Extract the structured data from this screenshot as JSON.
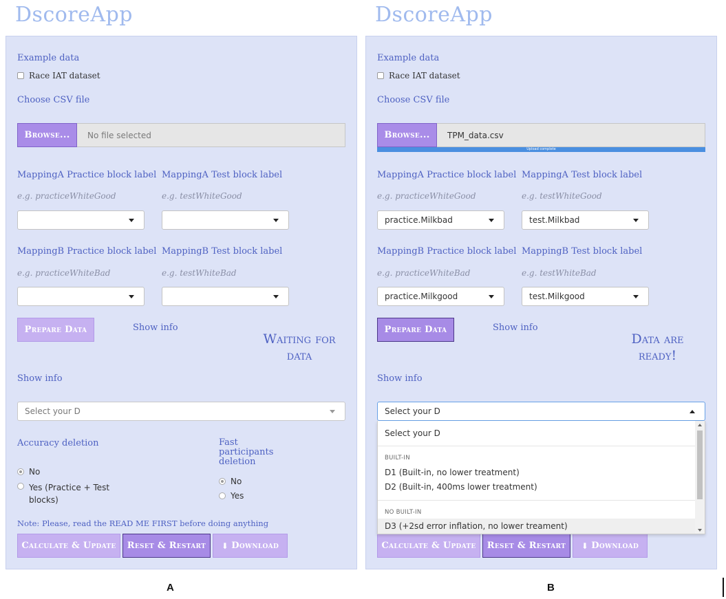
{
  "app_title": "DscoreApp",
  "panels": [
    {
      "figure_label": "A",
      "example_data_label": "Example data",
      "race_iat_label": "Race IAT dataset",
      "choose_csv_label": "Choose CSV file",
      "browse_label": "Browse...",
      "file_status": "No file selected",
      "mappingA_practice_label": "MappingA Practice block label",
      "mappingA_practice_hint": "e.g. practiceWhiteGood",
      "mappingA_practice_value": "",
      "mappingA_test_label": "MappingA Test block label",
      "mappingA_test_hint": "e.g. testWhiteGood",
      "mappingA_test_value": "",
      "mappingB_practice_label": "MappingB Practice block label",
      "mappingB_practice_hint": "e.g. practiceWhiteBad",
      "mappingB_practice_value": "",
      "mappingB_test_label": "MappingB Test block label",
      "mappingB_test_hint": "e.g. testWhiteBad",
      "mappingB_test_value": "",
      "prepare_label": "Prepare Data",
      "show_info_1": "Show info",
      "status_line1": "Waiting for",
      "status_line2": "data",
      "show_info_2": "Show info",
      "d_select_placeholder": "Select your D",
      "accuracy_label": "Accuracy deletion",
      "accuracy_no": "No",
      "accuracy_yes": "Yes (Practice + Test blocks)",
      "fast_label": "Fast participants deletion",
      "fast_no": "No",
      "fast_yes": "Yes",
      "note": "Note: Please, read the READ ME FIRST before doing anything",
      "calc_label": "Calculate & Update",
      "reset_label": "Reset & Restart",
      "download_label": "Download"
    },
    {
      "figure_label": "B",
      "example_data_label": "Example data",
      "race_iat_label": "Race IAT dataset",
      "choose_csv_label": "Choose CSV file",
      "browse_label": "Browse...",
      "file_status": "TPM_data.csv",
      "upload_status": "Upload complete",
      "mappingA_practice_label": "MappingA Practice block label",
      "mappingA_practice_hint": "e.g. practiceWhiteGood",
      "mappingA_practice_value": "practice.Milkbad",
      "mappingA_test_label": "MappingA Test block label",
      "mappingA_test_hint": "e.g. testWhiteGood",
      "mappingA_test_value": "test.Milkbad",
      "mappingB_practice_label": "MappingB Practice block label",
      "mappingB_practice_hint": "e.g. practiceWhiteBad",
      "mappingB_practice_value": "practice.Milkgood",
      "mappingB_test_label": "MappingB Test block label",
      "mappingB_test_hint": "e.g. testWhiteBad",
      "mappingB_test_value": "test.Milkgood",
      "prepare_label": "Prepare Data",
      "show_info_1": "Show info",
      "status_line1": "Data are",
      "status_line2": "ready!",
      "show_info_2": "Show info",
      "d_select_value": "Select your D",
      "dropdown": {
        "top_option": "Select your D",
        "group1": "BUILT-IN",
        "opt1": "D1 (Built-in, no lower treatment)",
        "opt2": "D2 (Built-in, 400ms lower treatment)",
        "group2": "NO BUILT-IN",
        "opt3": "D3 (+2sd error inflation, no lower treament)"
      },
      "calc_label": "Calculate & Update",
      "reset_label": "Reset & Restart",
      "download_label": "Download"
    }
  ]
}
